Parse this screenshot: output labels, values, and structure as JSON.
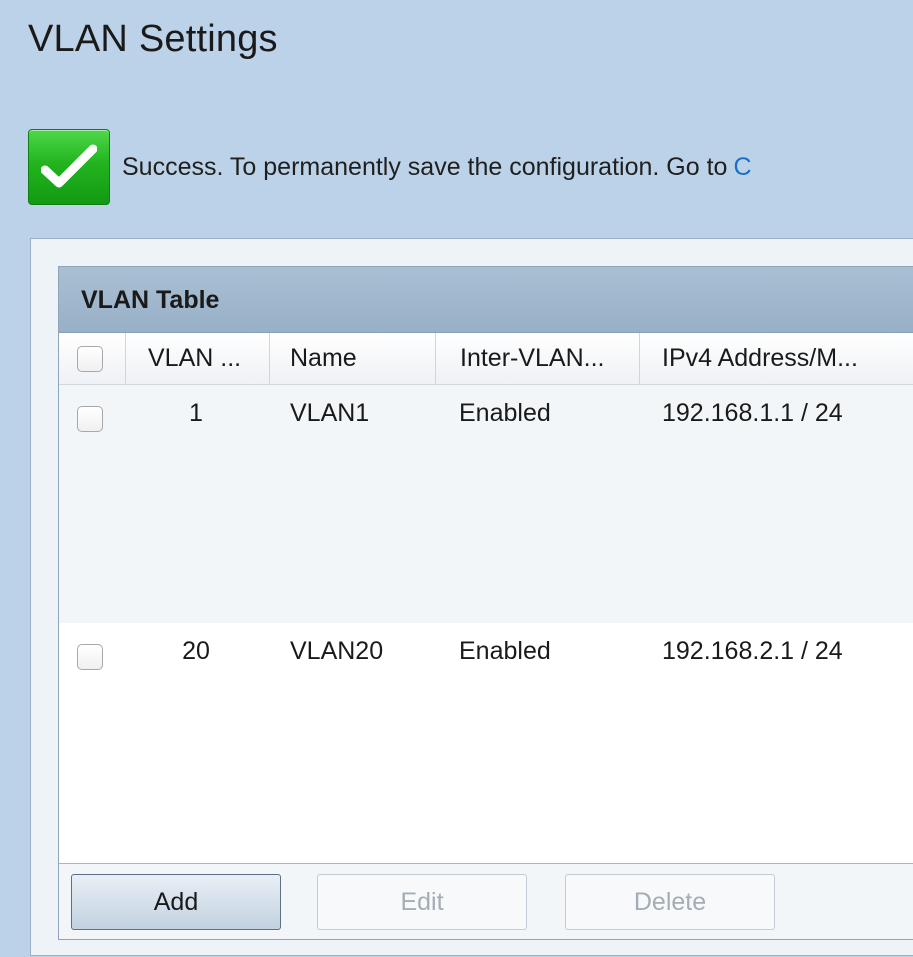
{
  "page": {
    "title": "VLAN Settings"
  },
  "message": {
    "text": "Success. To permanently save the configuration. Go to",
    "link_text": "C",
    "icon": "checkmark-icon",
    "color": "#22b41f"
  },
  "table": {
    "title": "VLAN Table",
    "columns": [
      "VLAN ...",
      "Name",
      "Inter-VLAN...",
      "IPv4 Address/M..."
    ],
    "rows": [
      {
        "vlan_id": "1",
        "name": "VLAN1",
        "inter_vlan": "Enabled",
        "ipv4": "192.168.1.1 / 24"
      },
      {
        "vlan_id": "20",
        "name": "VLAN20",
        "inter_vlan": "Enabled",
        "ipv4": "192.168.2.1 / 24"
      }
    ]
  },
  "buttons": {
    "add": "Add",
    "edit": "Edit",
    "delete": "Delete"
  }
}
